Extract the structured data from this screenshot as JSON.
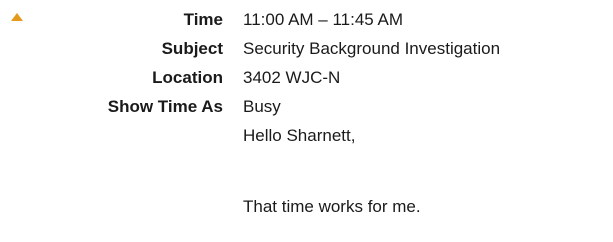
{
  "colors": {
    "accent": "#e39a1d",
    "text": "#1a1a1a"
  },
  "toggle": {
    "icon": "triangle-up-icon"
  },
  "meeting": {
    "time_label": "Time",
    "time_value": "11:00 AM – 11:45 AM",
    "subject_label": "Subject",
    "subject_value": "Security Background Investigation",
    "location_label": "Location",
    "location_value": "3402 WJC-N",
    "show_time_as_label": "Show Time As",
    "show_time_as_value": "Busy"
  },
  "message": {
    "greeting": "Hello Sharnett,",
    "body": "That time works for me."
  }
}
